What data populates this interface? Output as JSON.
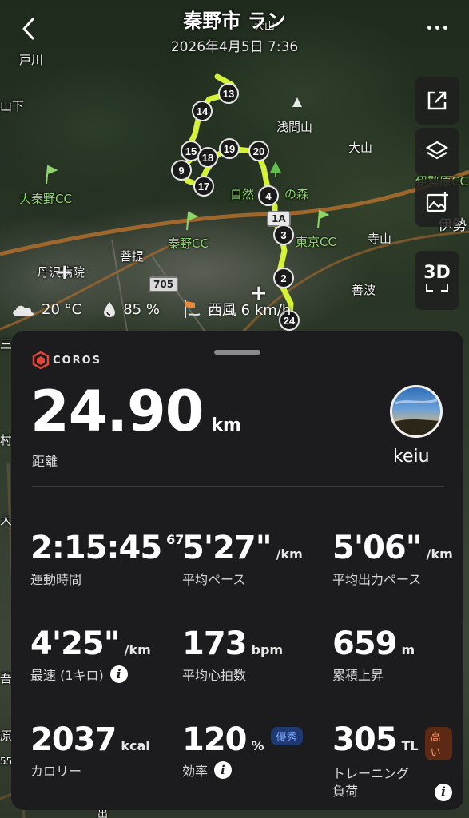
{
  "header": {
    "title": "秦野市 ラン",
    "datetime": "2026年4月5日 7:36"
  },
  "map": {
    "labels": [
      "戸川",
      "大山",
      "浅間山",
      "大山",
      "伊勢原CC",
      "伊勢",
      "大秦野CC",
      "自然",
      "の森",
      "秦野CC",
      "東京CC",
      "寺山",
      "菩提",
      "丹沢病院",
      "善波",
      "山下",
      "村",
      "原",
      "吾",
      "大",
      "三",
      "55",
      "出"
    ],
    "road_numbers": [
      "1A",
      "705"
    ],
    "route_markers": [
      "13",
      "14",
      "15",
      "19",
      "20",
      "18",
      "9",
      "17",
      "4",
      "3",
      "2",
      "24"
    ],
    "route_color": "#d4f23a"
  },
  "weather": {
    "temperature": "20 °C",
    "humidity": "85 %",
    "wind": "西風 6 km/h"
  },
  "controls": {
    "view_3d": "3D"
  },
  "summary": {
    "brand": "COROS",
    "distance_value": "24.90",
    "distance_unit": "km",
    "distance_label": "距離",
    "username": "keiu"
  },
  "stats": [
    {
      "value": "2:15:45",
      "sup": "67",
      "unit": "",
      "label": "運動時間"
    },
    {
      "value": "5'27\"",
      "unit": "/km",
      "label": "平均ペース"
    },
    {
      "value": "5'06\"",
      "unit": "/km",
      "label": "平均出力ペース"
    },
    {
      "value": "4'25\"",
      "unit": "/km",
      "label": "最速 (1キロ)"
    },
    {
      "value": "173",
      "unit": "bpm",
      "label": "平均心拍数"
    },
    {
      "value": "659",
      "unit": "m",
      "label": "累積上昇"
    },
    {
      "value": "2037",
      "unit": "kcal",
      "label": "カロリー"
    },
    {
      "value": "120",
      "unit": "%",
      "badge": "優秀",
      "label": "効率"
    },
    {
      "value": "305",
      "unit": "TL",
      "badge": "高い",
      "label": "トレーニング\n負荷"
    }
  ],
  "colors": {
    "sheet_bg": "#1c1c1e",
    "badge_blue": "#7fa8ff",
    "badge_orange": "#ff9a6b",
    "brand_red": "#e0463a"
  }
}
